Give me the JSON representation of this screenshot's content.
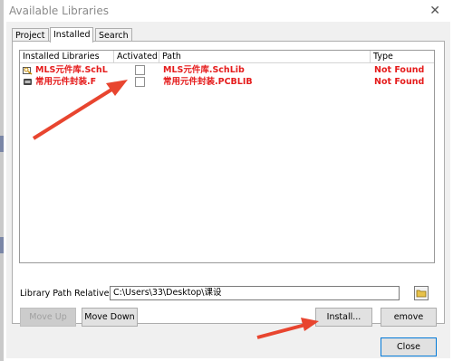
{
  "window": {
    "title": "Available Libraries",
    "close_glyph": "✕"
  },
  "tabs": [
    {
      "label": "Project"
    },
    {
      "label": "Installed"
    },
    {
      "label": "Search Path"
    }
  ],
  "active_tab": "Installed",
  "table": {
    "headers": [
      "Installed Libraries",
      "Activated",
      "Path",
      "Type"
    ],
    "rows": [
      {
        "library": "MLS元件库.SchL",
        "activated": false,
        "path": "MLS元件库.SchLib",
        "type": "Not Found",
        "icon": "schematic-library-icon"
      },
      {
        "library": "常用元件封装.F",
        "activated": false,
        "path": "常用元件封装.PCBLIB",
        "type": "Not Found",
        "icon": "pcb-library-icon"
      }
    ]
  },
  "relative_path": {
    "label": "Library Path Relative To:",
    "value": "C:\\Users\\33\\Desktop\\课设"
  },
  "buttons": {
    "move_up": "Move Up",
    "move_down": "Move Down",
    "install": "Install...",
    "remove": "emove",
    "close": "Close"
  },
  "colors": {
    "not_found": "#e51c1c",
    "annotation_arrow": "#e8452f"
  }
}
